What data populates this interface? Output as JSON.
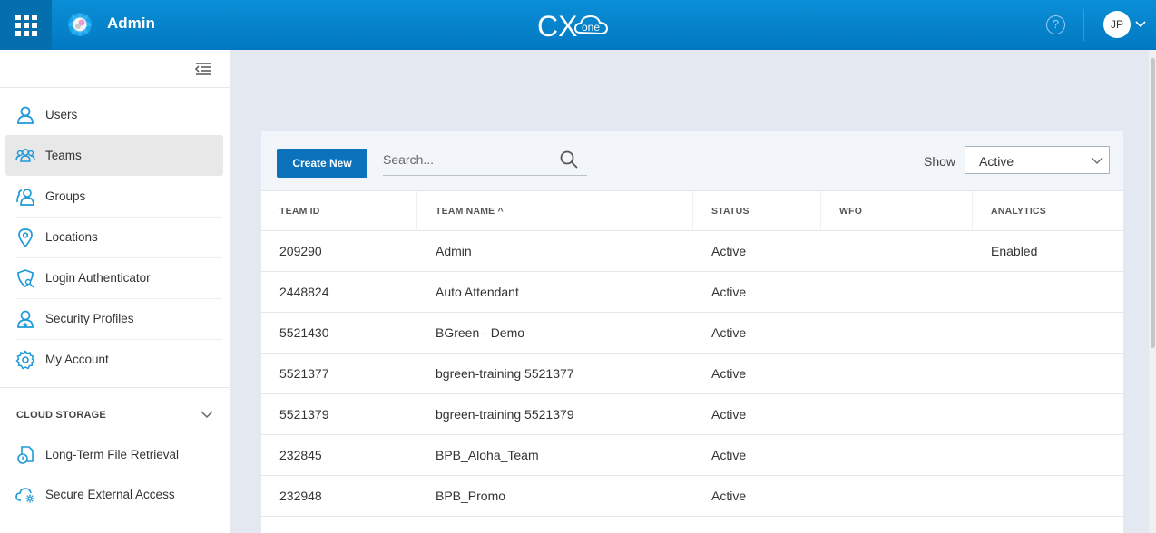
{
  "header": {
    "app_title": "Admin",
    "brand": "CXone",
    "help_glyph": "?",
    "user_initials": "JP"
  },
  "sidebar": {
    "items": [
      {
        "label": "Users",
        "icon": "user-icon",
        "active": false
      },
      {
        "label": "Teams",
        "icon": "team-icon",
        "active": true
      },
      {
        "label": "Groups",
        "icon": "group-icon",
        "active": false
      },
      {
        "label": "Locations",
        "icon": "location-pin-icon",
        "active": false
      },
      {
        "label": "Login Authenticator",
        "icon": "shield-key-icon",
        "active": false
      },
      {
        "label": "Security Profiles",
        "icon": "security-profile-icon",
        "active": false
      },
      {
        "label": "My Account",
        "icon": "gear-icon",
        "active": false
      }
    ],
    "section_title": "CLOUD STORAGE",
    "section_items": [
      {
        "label": "Long-Term File Retrieval",
        "icon": "file-clock-icon"
      },
      {
        "label": "Secure External Access",
        "icon": "cloud-gear-icon"
      }
    ]
  },
  "toolbar": {
    "create_label": "Create New",
    "search_placeholder": "Search...",
    "show_label": "Show",
    "show_value": "Active"
  },
  "table": {
    "columns": [
      "TEAM ID",
      "TEAM NAME",
      "STATUS",
      "WFO",
      "ANALYTICS"
    ],
    "sort_indicator": "^",
    "rows": [
      {
        "team_id": "209290",
        "team_name": "Admin",
        "status": "Active",
        "wfo": "",
        "analytics": "Enabled"
      },
      {
        "team_id": "2448824",
        "team_name": "Auto Attendant",
        "status": "Active",
        "wfo": "",
        "analytics": ""
      },
      {
        "team_id": "5521430",
        "team_name": "BGreen - Demo",
        "status": "Active",
        "wfo": "",
        "analytics": ""
      },
      {
        "team_id": "5521377",
        "team_name": "bgreen-training 5521377",
        "status": "Active",
        "wfo": "",
        "analytics": ""
      },
      {
        "team_id": "5521379",
        "team_name": "bgreen-training 5521379",
        "status": "Active",
        "wfo": "",
        "analytics": ""
      },
      {
        "team_id": "232845",
        "team_name": "BPB_Aloha_Team",
        "status": "Active",
        "wfo": "",
        "analytics": ""
      },
      {
        "team_id": "232948",
        "team_name": "BPB_Promo",
        "status": "Active",
        "wfo": "",
        "analytics": ""
      }
    ]
  },
  "colors": {
    "header_blue": "#0a8fd6",
    "accent_blue": "#0b72bb",
    "icon_blue": "#1f9ad8"
  }
}
